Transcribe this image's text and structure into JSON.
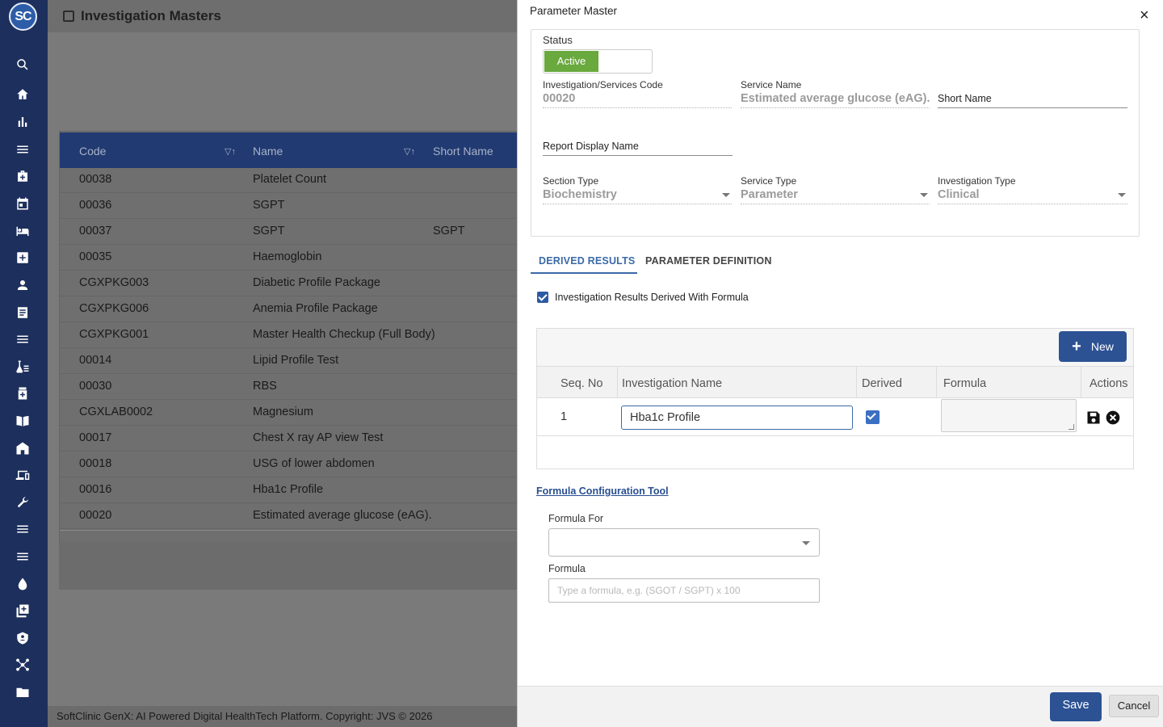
{
  "app": {
    "logo_text": "SC",
    "page_title": "Investigation Masters",
    "footer": "SoftClinic GenX: AI Powered Digital HealthTech Platform. Copyright: JVS © 2026"
  },
  "sidebar": {
    "icons": [
      "search-icon",
      "home-icon",
      "bar-chart-icon",
      "menu-icon",
      "medical-bag-icon",
      "calendar-icon",
      "bed-icon",
      "plus-box-icon",
      "user-icon",
      "document-icon",
      "list-icon",
      "lab-icon",
      "pharmacy-icon",
      "book-icon",
      "building-icon",
      "devices-icon",
      "wrench-icon",
      "menu-icon-2",
      "menu-icon-3",
      "drop-icon",
      "add-box-icon",
      "shield-icon",
      "network-icon",
      "folder-icon"
    ]
  },
  "table": {
    "headers": {
      "code": "Code",
      "name": "Name",
      "short_name": "Short Name"
    },
    "rows": [
      {
        "code": "00038",
        "name": "Platelet Count",
        "short": ""
      },
      {
        "code": "00036",
        "name": "SGPT",
        "short": ""
      },
      {
        "code": "00037",
        "name": "SGPT",
        "short": "SGPT"
      },
      {
        "code": "00035",
        "name": "Haemoglobin",
        "short": ""
      },
      {
        "code": "CGXPKG003",
        "name": "Diabetic Profile Package",
        "short": ""
      },
      {
        "code": "CGXPKG006",
        "name": "Anemia Profile Package",
        "short": ""
      },
      {
        "code": "CGXPKG001",
        "name": "Master Health Checkup (Full Body)",
        "short": ""
      },
      {
        "code": "00014",
        "name": "Lipid Profile Test",
        "short": ""
      },
      {
        "code": "00030",
        "name": "RBS",
        "short": ""
      },
      {
        "code": "CGXLAB0002",
        "name": "Magnesium",
        "short": ""
      },
      {
        "code": "00017",
        "name": "Chest X ray AP view Test",
        "short": ""
      },
      {
        "code": "00018",
        "name": "USG of lower abdomen",
        "short": ""
      },
      {
        "code": "00016",
        "name": "Hba1c Profile",
        "short": ""
      },
      {
        "code": "00020",
        "name": "Estimated average glucose (eAG).",
        "short": ""
      }
    ]
  },
  "drawer": {
    "title": "Parameter Master",
    "close": "×",
    "status_label": "Status",
    "status_value": "Active",
    "code_label": "Investigation/Services Code",
    "code_value": "00020",
    "service_name_label": "Service Name",
    "service_name_value": "Estimated average glucose (eAG).",
    "short_name_label": "Short Name",
    "report_display_label": "Report Display Name",
    "section_type_label": "Section Type",
    "section_type_value": "Biochemistry",
    "service_type_label": "Service Type",
    "service_type_value": "Parameter",
    "investigation_type_label": "Investigation Type",
    "investigation_type_value": "Clinical",
    "tabs": {
      "derived": "DERIVED RESULTS",
      "definition": "PARAMETER DEFINITION"
    },
    "derived_checkbox_label": "Investigation Results Derived With Formula",
    "new_button": "New",
    "grid_headers": {
      "seq": "Seq. No",
      "inv_name": "Investigation Name",
      "derived": "Derived",
      "formula": "Formula",
      "actions": "Actions"
    },
    "grid_row": {
      "seq": "1",
      "inv_name": "Hba1c Profile"
    },
    "formula_tool_link": "Formula Configuration Tool",
    "formula_for_label": "Formula For",
    "formula_label": "Formula",
    "formula_placeholder": "Type a formula, e.g. (SGOT / SGPT) x 100",
    "save": "Save",
    "cancel": "Cancel"
  },
  "colors": {
    "sidebar": "#1d2f5c",
    "primary": "#2c5294",
    "active_green": "#6aa93e",
    "table_header": "#213a71"
  }
}
